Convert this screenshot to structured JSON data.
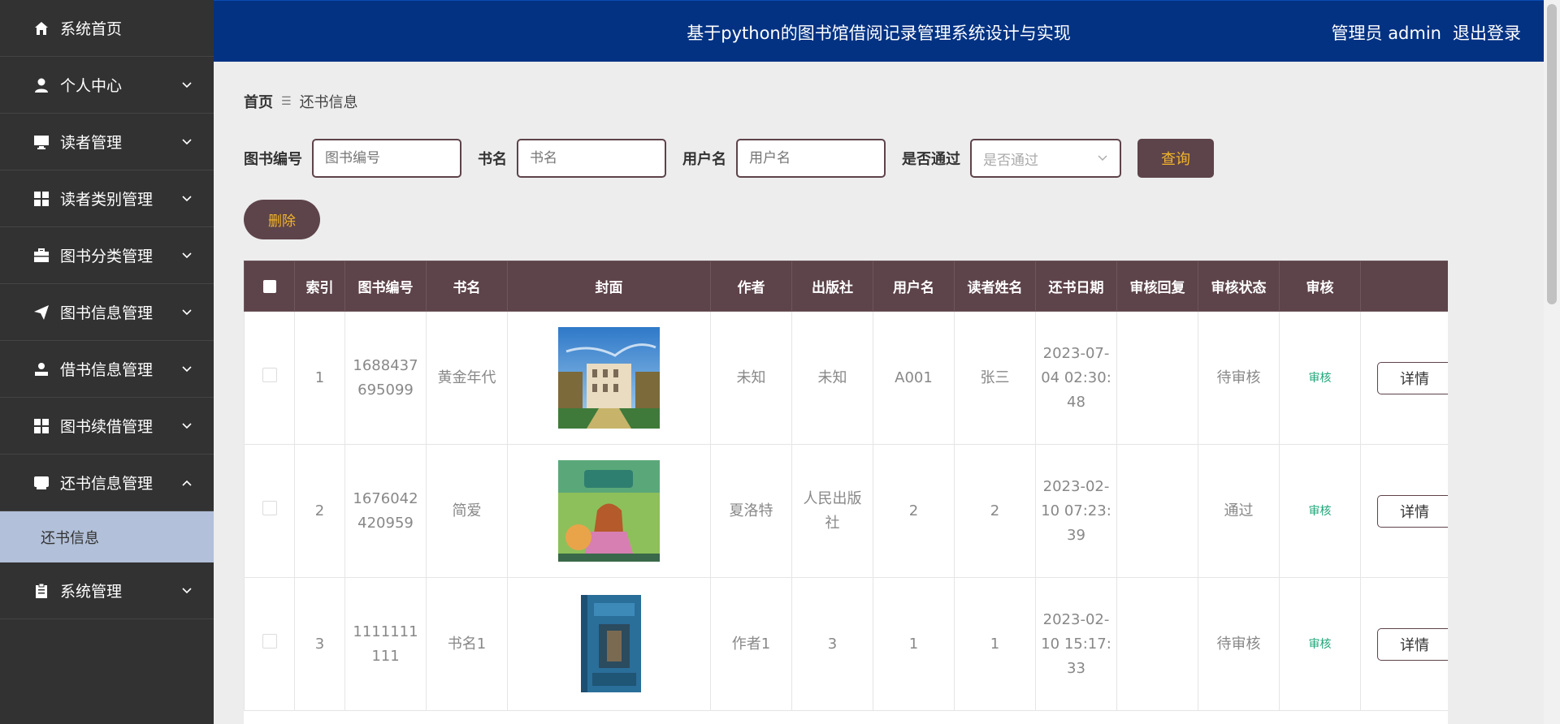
{
  "header": {
    "title": "基于python的图书馆借阅记录管理系统设计与实现",
    "user_label": "管理员 admin",
    "logout": "退出登录"
  },
  "sidebar": {
    "items": [
      {
        "label": "系统首页",
        "icon": "home-icon"
      },
      {
        "label": "个人中心",
        "icon": "user-icon"
      },
      {
        "label": "读者管理",
        "icon": "monitor-icon"
      },
      {
        "label": "读者类别管理",
        "icon": "grid-icon"
      },
      {
        "label": "图书分类管理",
        "icon": "briefcase-icon"
      },
      {
        "label": "图书信息管理",
        "icon": "send-icon"
      },
      {
        "label": "借书信息管理",
        "icon": "person-icon"
      },
      {
        "label": "图书续借管理",
        "icon": "grid-icon"
      },
      {
        "label": "还书信息管理",
        "icon": "inbox-icon"
      },
      {
        "label": "系统管理",
        "icon": "clipboard-icon"
      }
    ],
    "sub_item": "还书信息"
  },
  "breadcrumb": {
    "home": "首页",
    "sep": "☰",
    "current": "还书信息"
  },
  "filters": {
    "book_no_label": "图书编号",
    "book_no_placeholder": "图书编号",
    "book_name_label": "书名",
    "book_name_placeholder": "书名",
    "username_label": "用户名",
    "username_placeholder": "用户名",
    "passed_label": "是否通过",
    "passed_placeholder": "是否通过",
    "query": "查询"
  },
  "delete_label": "删除",
  "table": {
    "headers": [
      "索引",
      "图书编号",
      "书名",
      "封面",
      "作者",
      "出版社",
      "用户名",
      "读者姓名",
      "还书日期",
      "审核回复",
      "审核状态",
      "审核",
      ""
    ],
    "rows": [
      {
        "index": "1",
        "book_no": "1688437695099",
        "name": "黄金年代",
        "author": "未知",
        "publisher": "未知",
        "username": "A001",
        "reader": "张三",
        "date": "2023-07-04 02:30:48",
        "reply": "",
        "status": "待审核",
        "audit": "审核",
        "detail": "详情"
      },
      {
        "index": "2",
        "book_no": "1676042420959",
        "name": "简爱",
        "author": "夏洛特",
        "publisher": "人民出版社",
        "username": "2",
        "reader": "2",
        "date": "2023-02-10 07:23:39",
        "reply": "",
        "status": "通过",
        "audit": "审核",
        "detail": "详情"
      },
      {
        "index": "3",
        "book_no": "1111111111",
        "name": "书名1",
        "author": "作者1",
        "publisher": "3",
        "username": "1",
        "reader": "1",
        "date": "2023-02-10 15:17:33",
        "reply": "",
        "status": "待审核",
        "audit": "审核",
        "detail": "详情"
      }
    ]
  },
  "colors": {
    "header_bg": "#033283",
    "sidebar_bg": "#323232",
    "accent": "#5d434a",
    "accent_text": "#f3b62a",
    "audit_link": "#1fa67a"
  }
}
